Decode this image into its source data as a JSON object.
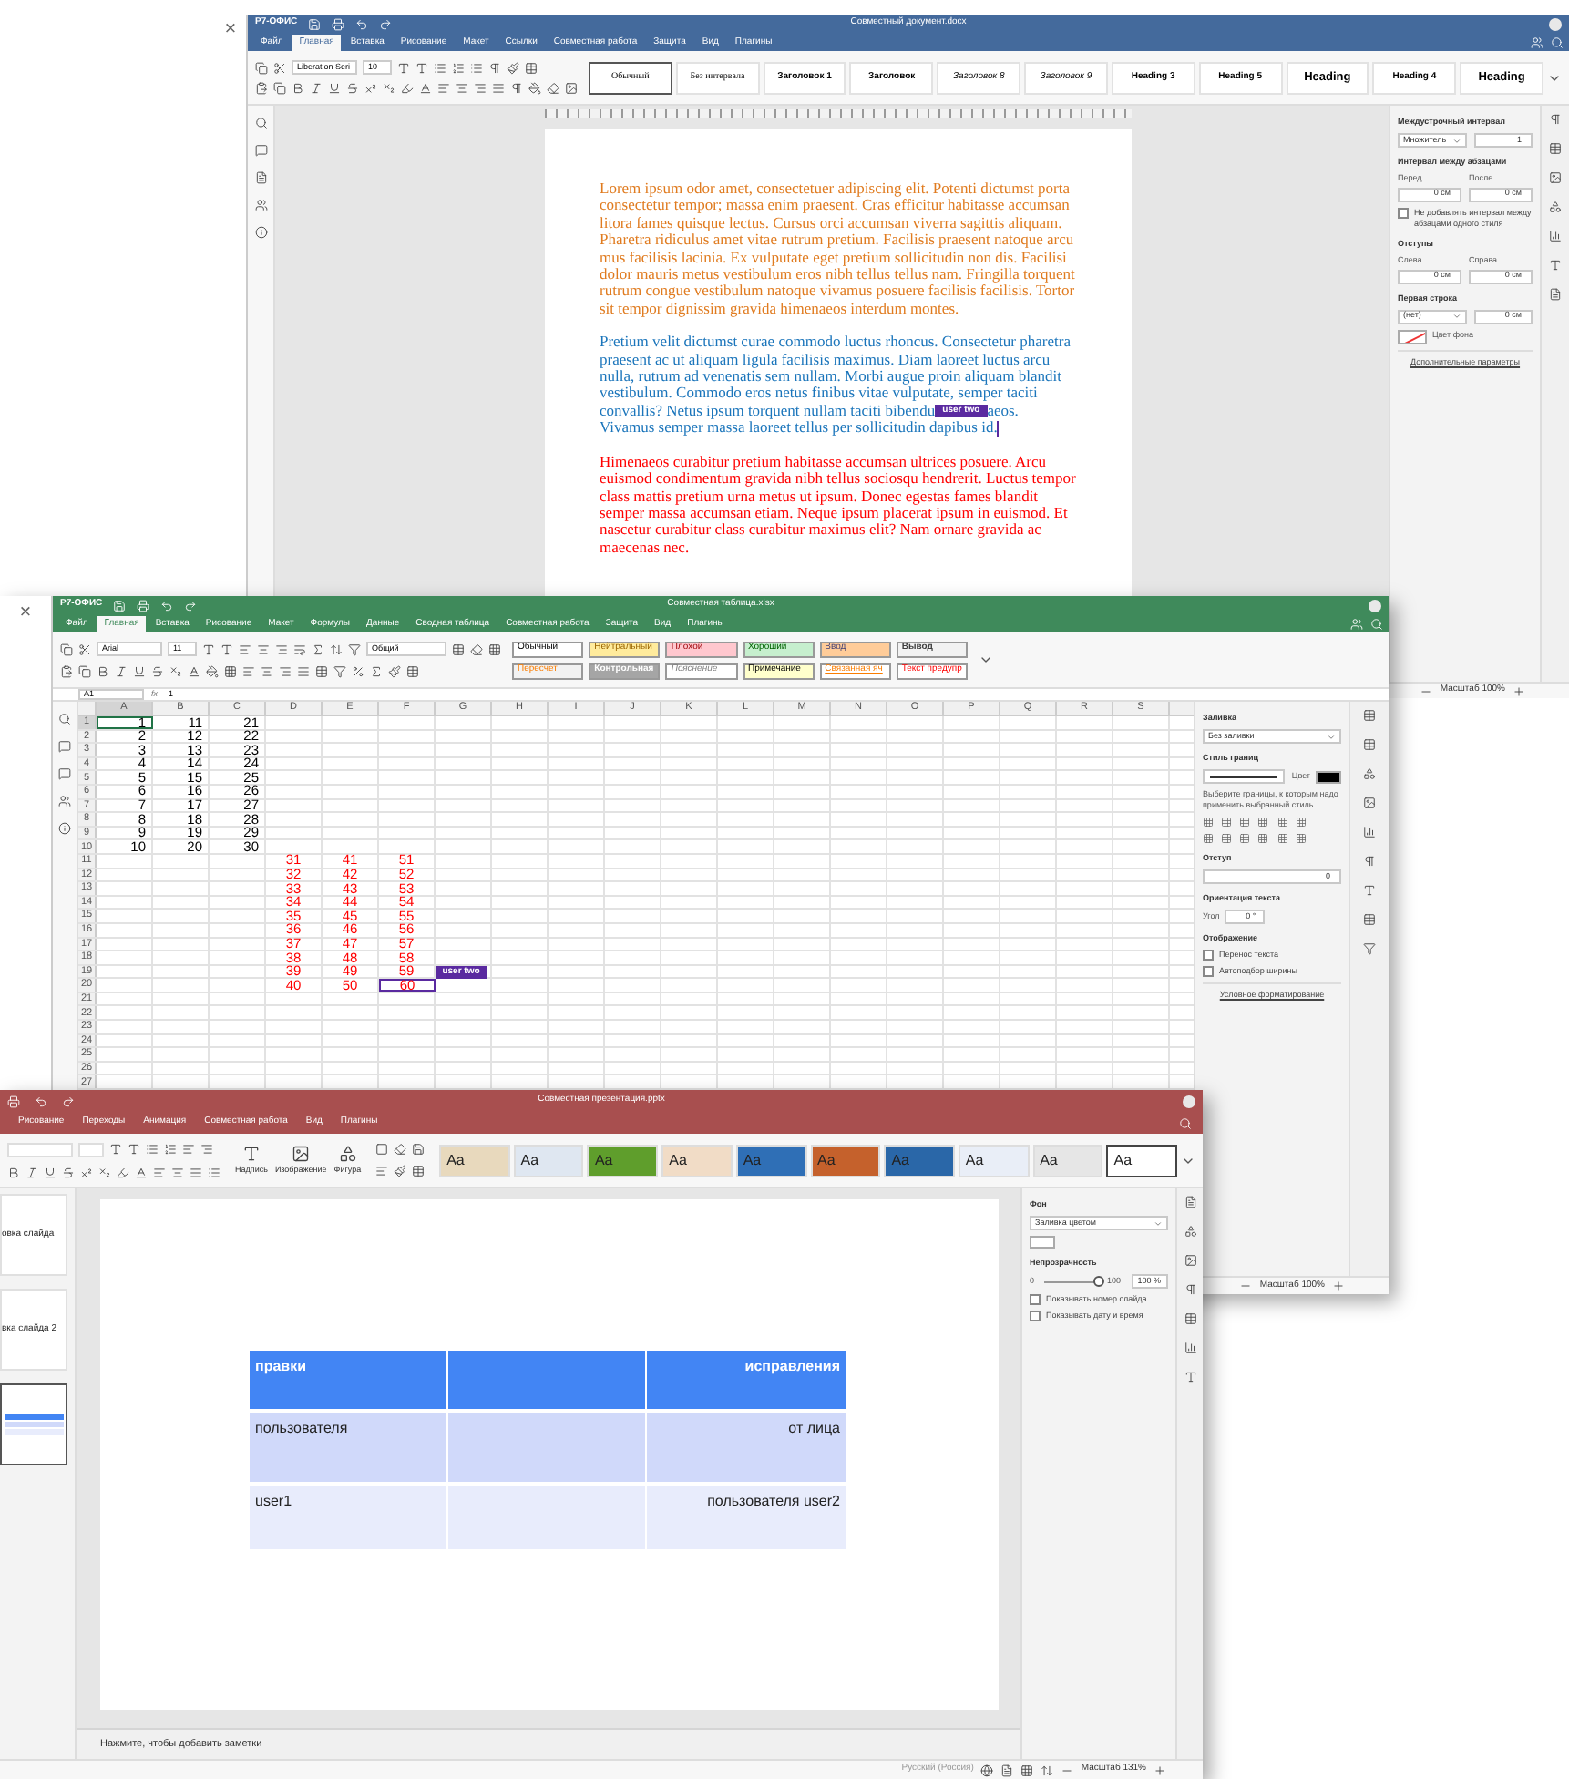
{
  "document_window": {
    "close_glyph": "×",
    "logo": "Р7-ОФИС",
    "title": "Совместный документ.docx",
    "menu": [
      {
        "label": "Файл",
        "selected": false
      },
      {
        "label": "Главная",
        "selected": true
      },
      {
        "label": "Вставка",
        "selected": false
      },
      {
        "label": "Рисование",
        "selected": false
      },
      {
        "label": "Макет",
        "selected": false
      },
      {
        "label": "Ссылки",
        "selected": false
      },
      {
        "label": "Совместная работа",
        "selected": false
      },
      {
        "label": "Защита",
        "selected": false
      },
      {
        "label": "Вид",
        "selected": false
      },
      {
        "label": "Плагины",
        "selected": false
      }
    ],
    "font": {
      "name": "Liberation Seri",
      "size": "10"
    },
    "styles": [
      {
        "label": "Обычный",
        "kind": "plain",
        "selected": true
      },
      {
        "label": "Без интервала",
        "kind": "plain",
        "selected": false
      },
      {
        "label": "Заголовок 1",
        "kind": "bold",
        "selected": false
      },
      {
        "label": "Заголовок",
        "kind": "bold",
        "selected": false
      },
      {
        "label": "Заголовок 8",
        "kind": "italic",
        "selected": false
      },
      {
        "label": "Заголовок 9",
        "kind": "italic",
        "selected": false
      },
      {
        "label": "Heading 3",
        "kind": "bold",
        "selected": false
      },
      {
        "label": "Heading 5",
        "kind": "bold",
        "selected": false
      },
      {
        "label": "Heading",
        "kind": "large",
        "selected": false
      },
      {
        "label": "Heading 4",
        "kind": "bold",
        "selected": false
      },
      {
        "label": "Heading",
        "kind": "large",
        "selected": false
      }
    ],
    "paragraphs": [
      {
        "color": "#e07b1f",
        "text": "Lorem ipsum odor amet, consectetuer adipiscing elit. Potenti dictumst porta consectetur tempor; massa enim praesent. Cras efficitur habitasse accumsan litora fames quisque lectus. Cursus orci accumsan viverra sagittis aliquam. Pharetra ridiculus amet vitae rutrum pretium. Facilisis praesent natoque arcu mus facilisis lacinia. Ex vulputate eget pretium sollicitudin non dis. Facilisi dolor mauris metus vestibulum eros nibh tellus tellus nam. Fringilla torquent rutrum congue vestibulum natoque vivamus posuere facilisis facilisis. Tortor sit tempor dignissim gravida himenaeos interdum montes."
      },
      {
        "color": "#1b75bb",
        "text": "Pretium velit dictumst curae commodo luctus rhoncus. Consectetur pharetra praesent ac ut aliquam ligula facilisis maximus. Diam laoreet luctus arcu nulla, rutrum ad venenatis sem nullam. Morbi augue proin aliquam blandit vestibulum. Commodo eros netus finibus vitae vulputate, semper taciti convallis? Netus ipsum torquent nullam taciti bibendu",
        "remote_tag": "user two",
        "text_after": "aeos. Vivamus semper massa laoreet tellus per sollicitudin dapibus id."
      },
      {
        "color": "#ff0000",
        "text": "Himenaeos curabitur pretium habitasse accumsan ultrices posuere. Arcu euismod condimentum gravida nibh tellus sociosqu hendrerit. Luctus tempor class mattis pretium urna metus ut ipsum. Donec egestas fames blandit semper massa accumsan etiam. Neque ipsum placerat ipsum in euismod. Et nascetur curabitur class curabitur maximus elit? Nam ornare gravida ac maecenas nec."
      }
    ],
    "panel": [
      {
        "kind": "heading",
        "text": "Междустрочный интервал"
      },
      {
        "kind": "row",
        "fields": [
          {
            "kind": "dropdown",
            "value": "Множитель"
          },
          {
            "kind": "spinner",
            "value": "1"
          }
        ]
      },
      {
        "kind": "heading",
        "text": "Интервал между абзацами"
      },
      {
        "kind": "row",
        "fields": [
          {
            "kind": "spinner",
            "label": "Перед",
            "value": "0 см"
          },
          {
            "kind": "spinner",
            "label": "После",
            "value": "0 см"
          }
        ]
      },
      {
        "kind": "checkbox",
        "text": "Не добавлять интервал между абзацами одного стиля",
        "checked": false
      },
      {
        "kind": "heading",
        "text": "Отступы"
      },
      {
        "kind": "row",
        "fields": [
          {
            "kind": "spinner",
            "label": "Слева",
            "value": "0 см"
          },
          {
            "kind": "spinner",
            "label": "Справа",
            "value": "0 см"
          }
        ]
      },
      {
        "kind": "heading",
        "text": "Первая строка"
      },
      {
        "kind": "row",
        "fields": [
          {
            "kind": "dropdown",
            "value": "(нет)"
          },
          {
            "kind": "spinner",
            "value": "0 см"
          }
        ]
      },
      {
        "kind": "row",
        "fields": [
          {
            "kind": "empty_swatch",
            "label": "Цвет фона"
          }
        ]
      },
      {
        "kind": "link",
        "text": "Дополнительные параметры"
      }
    ],
    "status": {
      "zoom": "Масштаб 100%"
    }
  },
  "spreadsheet_window": {
    "close_glyph": "×",
    "logo": "Р7-ОФИС",
    "title": "Совместная таблица.xlsx",
    "menu": [
      {
        "label": "Файл",
        "selected": false
      },
      {
        "label": "Главная",
        "selected": true
      },
      {
        "label": "Вставка",
        "selected": false
      },
      {
        "label": "Рисование",
        "selected": false
      },
      {
        "label": "Макет",
        "selected": false
      },
      {
        "label": "Формулы",
        "selected": false
      },
      {
        "label": "Данные",
        "selected": false
      },
      {
        "label": "Сводная таблица",
        "selected": false
      },
      {
        "label": "Совместная работа",
        "selected": false
      },
      {
        "label": "Защита",
        "selected": false
      },
      {
        "label": "Вид",
        "selected": false
      },
      {
        "label": "Плагины",
        "selected": false
      }
    ],
    "font": {
      "name": "Arial",
      "size": "11"
    },
    "number_format": "Общий",
    "cell_styles": [
      {
        "label": "Обычный",
        "color": "#ffffff",
        "kind": "normal"
      },
      {
        "label": "Нейтральный",
        "color": "#ffeb9c",
        "kind": "neutral"
      },
      {
        "label": "Плохой",
        "color": "#ffc7ce",
        "kind": "bad"
      },
      {
        "label": "Хороший",
        "color": "#c6efce",
        "kind": "good"
      },
      {
        "label": "Ввод",
        "color": "#ffcc99",
        "kind": "input"
      },
      {
        "label": "Вывод",
        "color": "#f2f2f2",
        "kind": "output"
      },
      {
        "label": "Пересчет",
        "color": "#f2f2f2",
        "kind": "calculation"
      },
      {
        "label": "Контрольная",
        "color": "#a5a5a5",
        "kind": "check"
      },
      {
        "label": "Пояснение",
        "color": "#ffffff",
        "kind": "explanatory"
      },
      {
        "label": "Примечание",
        "color": "#ffffcc",
        "kind": "note"
      },
      {
        "label": "Связанная яч",
        "color": "#ffffff",
        "kind": "linked"
      },
      {
        "label": "Текст предупр",
        "color": "#ffffff",
        "kind": "warning"
      }
    ],
    "name_box": "A1",
    "function_glyph": "fx",
    "formula": "1",
    "columns": [
      "A",
      "B",
      "C",
      "D",
      "E",
      "F",
      "G",
      "H",
      "I",
      "J",
      "K",
      "L",
      "M",
      "N",
      "O",
      "P",
      "Q",
      "R",
      "S"
    ],
    "rows": [
      {
        "number": "1",
        "kind": "left_block",
        "cells": [
          {
            "value": "1",
            "color": "#000000",
            "selected": true,
            "remote_cursor": false
          },
          {
            "value": "11",
            "color": "#000000",
            "selected": false,
            "remote_cursor": false
          },
          {
            "value": "21",
            "color": "#000000",
            "selected": false,
            "remote_cursor": false
          }
        ]
      },
      {
        "number": "2",
        "kind": "left_block",
        "cells": [
          {
            "value": "2",
            "color": "#000000",
            "selected": false,
            "remote_cursor": false
          },
          {
            "value": "12",
            "color": "#000000",
            "selected": false,
            "remote_cursor": false
          },
          {
            "value": "22",
            "color": "#000000",
            "selected": false,
            "remote_cursor": false
          }
        ]
      },
      {
        "number": "3",
        "kind": "left_block",
        "cells": [
          {
            "value": "3",
            "color": "#000000",
            "selected": false,
            "remote_cursor": false
          },
          {
            "value": "13",
            "color": "#000000",
            "selected": false,
            "remote_cursor": false
          },
          {
            "value": "23",
            "color": "#000000",
            "selected": false,
            "remote_cursor": false
          }
        ]
      },
      {
        "number": "4",
        "kind": "left_block",
        "cells": [
          {
            "value": "4",
            "color": "#000000",
            "selected": false,
            "remote_cursor": false
          },
          {
            "value": "14",
            "color": "#000000",
            "selected": false,
            "remote_cursor": false
          },
          {
            "value": "24",
            "color": "#000000",
            "selected": false,
            "remote_cursor": false
          }
        ]
      },
      {
        "number": "5",
        "kind": "left_block",
        "cells": [
          {
            "value": "5",
            "color": "#000000",
            "selected": false,
            "remote_cursor": false
          },
          {
            "value": "15",
            "color": "#000000",
            "selected": false,
            "remote_cursor": false
          },
          {
            "value": "25",
            "color": "#000000",
            "selected": false,
            "remote_cursor": false
          }
        ]
      },
      {
        "number": "6",
        "kind": "left_block",
        "cells": [
          {
            "value": "6",
            "color": "#000000",
            "selected": false,
            "remote_cursor": false
          },
          {
            "value": "16",
            "color": "#000000",
            "selected": false,
            "remote_cursor": false
          },
          {
            "value": "26",
            "color": "#000000",
            "selected": false,
            "remote_cursor": false
          }
        ]
      },
      {
        "number": "7",
        "kind": "left_block",
        "cells": [
          {
            "value": "7",
            "color": "#000000",
            "selected": false,
            "remote_cursor": false
          },
          {
            "value": "17",
            "color": "#000000",
            "selected": false,
            "remote_cursor": false
          },
          {
            "value": "27",
            "color": "#000000",
            "selected": false,
            "remote_cursor": false
          }
        ]
      },
      {
        "number": "8",
        "kind": "left_block",
        "cells": [
          {
            "value": "8",
            "color": "#000000",
            "selected": false,
            "remote_cursor": false
          },
          {
            "value": "18",
            "color": "#000000",
            "selected": false,
            "remote_cursor": false
          },
          {
            "value": "28",
            "color": "#000000",
            "selected": false,
            "remote_cursor": false
          }
        ]
      },
      {
        "number": "9",
        "kind": "left_block",
        "cells": [
          {
            "value": "9",
            "color": "#000000",
            "selected": false,
            "remote_cursor": false
          },
          {
            "value": "19",
            "color": "#000000",
            "selected": false,
            "remote_cursor": false
          },
          {
            "value": "29",
            "color": "#000000",
            "selected": false,
            "remote_cursor": false
          }
        ]
      },
      {
        "number": "10",
        "kind": "left_block",
        "cells": [
          {
            "value": "10",
            "color": "#000000",
            "selected": false,
            "remote_cursor": false
          },
          {
            "value": "20",
            "color": "#000000",
            "selected": false,
            "remote_cursor": false
          },
          {
            "value": "30",
            "color": "#000000",
            "selected": false,
            "remote_cursor": false
          }
        ]
      },
      {
        "number": "11",
        "kind": "middle_block",
        "cells": [
          {
            "value": "31",
            "color": "#ff0000",
            "selected": false,
            "remote_cursor": false
          },
          {
            "value": "41",
            "color": "#ff0000",
            "selected": false,
            "remote_cursor": false
          },
          {
            "value": "51",
            "color": "#ff0000",
            "selected": false,
            "remote_cursor": false
          }
        ]
      },
      {
        "number": "12",
        "kind": "middle_block",
        "cells": [
          {
            "value": "32",
            "color": "#ff0000",
            "selected": false,
            "remote_cursor": false
          },
          {
            "value": "42",
            "color": "#ff0000",
            "selected": false,
            "remote_cursor": false
          },
          {
            "value": "52",
            "color": "#ff0000",
            "selected": false,
            "remote_cursor": false
          }
        ]
      },
      {
        "number": "13",
        "kind": "middle_block",
        "cells": [
          {
            "value": "33",
            "color": "#ff0000",
            "selected": false,
            "remote_cursor": false
          },
          {
            "value": "43",
            "color": "#ff0000",
            "selected": false,
            "remote_cursor": false
          },
          {
            "value": "53",
            "color": "#ff0000",
            "selected": false,
            "remote_cursor": false
          }
        ]
      },
      {
        "number": "14",
        "kind": "middle_block",
        "cells": [
          {
            "value": "34",
            "color": "#ff0000",
            "selected": false,
            "remote_cursor": false
          },
          {
            "value": "44",
            "color": "#ff0000",
            "selected": false,
            "remote_cursor": false
          },
          {
            "value": "54",
            "color": "#ff0000",
            "selected": false,
            "remote_cursor": false
          }
        ]
      },
      {
        "number": "15",
        "kind": "middle_block",
        "cells": [
          {
            "value": "35",
            "color": "#ff0000",
            "selected": false,
            "remote_cursor": false
          },
          {
            "value": "45",
            "color": "#ff0000",
            "selected": false,
            "remote_cursor": false
          },
          {
            "value": "55",
            "color": "#ff0000",
            "selected": false,
            "remote_cursor": false
          }
        ]
      },
      {
        "number": "16",
        "kind": "middle_block",
        "cells": [
          {
            "value": "36",
            "color": "#ff0000",
            "selected": false,
            "remote_cursor": false
          },
          {
            "value": "46",
            "color": "#ff0000",
            "selected": false,
            "remote_cursor": false
          },
          {
            "value": "56",
            "color": "#ff0000",
            "selected": false,
            "remote_cursor": false
          }
        ]
      },
      {
        "number": "17",
        "kind": "middle_block",
        "cells": [
          {
            "value": "37",
            "color": "#ff0000",
            "selected": false,
            "remote_cursor": false
          },
          {
            "value": "47",
            "color": "#ff0000",
            "selected": false,
            "remote_cursor": false
          },
          {
            "value": "57",
            "color": "#ff0000",
            "selected": false,
            "remote_cursor": false
          }
        ]
      },
      {
        "number": "18",
        "kind": "middle_block",
        "cells": [
          {
            "value": "38",
            "color": "#ff0000",
            "selected": false,
            "remote_cursor": false
          },
          {
            "value": "48",
            "color": "#ff0000",
            "selected": false,
            "remote_cursor": false
          },
          {
            "value": "58",
            "color": "#ff0000",
            "selected": false,
            "remote_cursor": false
          }
        ]
      },
      {
        "number": "19",
        "kind": "middle_block",
        "cells": [
          {
            "value": "39",
            "color": "#ff0000",
            "selected": false,
            "remote_cursor": false
          },
          {
            "value": "49",
            "color": "#ff0000",
            "selected": false,
            "remote_cursor": false
          },
          {
            "value": "59",
            "color": "#ff0000",
            "selected": false,
            "remote_cursor": false
          }
        ]
      },
      {
        "number": "20",
        "kind": "middle_block",
        "cells": [
          {
            "value": "40",
            "color": "#ff0000",
            "selected": false,
            "remote_cursor": false
          },
          {
            "value": "50",
            "color": "#ff0000",
            "selected": false,
            "remote_cursor": false
          },
          {
            "value": "60",
            "color": "#ff0000",
            "selected": false,
            "remote_cursor": true
          }
        ]
      },
      {
        "number": "21"
      },
      {
        "number": "22"
      },
      {
        "number": "23"
      },
      {
        "number": "24"
      },
      {
        "number": "25"
      },
      {
        "number": "26"
      },
      {
        "number": "27"
      }
    ],
    "remote_tag": "user two",
    "panel": [
      {
        "kind": "heading",
        "text": "Заливка"
      },
      {
        "kind": "row",
        "fields": [
          {
            "kind": "dropdown",
            "value": "Без заливки"
          }
        ]
      },
      {
        "kind": "heading",
        "text": "Стиль границ"
      },
      {
        "kind": "row",
        "fields": [
          {
            "kind": "line"
          },
          {
            "kind": "color",
            "label": "Цвет",
            "color": "#000000"
          }
        ]
      },
      {
        "kind": "label",
        "text": "Выберите границы, к которым надо применить выбранный стиль"
      },
      {
        "kind": "border_icons"
      },
      {
        "kind": "heading",
        "text": "Отступ"
      },
      {
        "kind": "row",
        "fields": [
          {
            "kind": "spinner",
            "value": "0"
          }
        ]
      },
      {
        "kind": "heading",
        "text": "Ориентация текста"
      },
      {
        "kind": "row",
        "fields": [
          {
            "kind": "inline_spinner",
            "label": "Угол",
            "value": "0 °"
          }
        ]
      },
      {
        "kind": "heading",
        "text": "Отображение"
      },
      {
        "kind": "checkbox",
        "text": "Перенос текста",
        "checked": false
      },
      {
        "kind": "checkbox",
        "text": "Автоподбор ширины",
        "checked": false
      },
      {
        "kind": "link",
        "text": "Условное форматирование"
      }
    ],
    "status": {
      "zoom": "Масштаб 100%"
    }
  },
  "presentation_window": {
    "title": "Совместная презентация.pptx",
    "menu": [
      {
        "label": "Рисование",
        "selected": false
      },
      {
        "label": "Переходы",
        "selected": false
      },
      {
        "label": "Анимация",
        "selected": false
      },
      {
        "label": "Совместная работа",
        "selected": false
      },
      {
        "label": "Вид",
        "selected": false
      },
      {
        "label": "Плагины",
        "selected": false
      }
    ],
    "insert_tools": [
      {
        "label": "Надпись"
      },
      {
        "label": "Изображение"
      },
      {
        "label": "Фигура"
      }
    ],
    "themes": [
      {
        "label": "Aa",
        "color": "#e8d9bd",
        "selected": false
      },
      {
        "label": "Aa",
        "color": "#dfe7f1",
        "selected": false
      },
      {
        "label": "Aa",
        "color": "#5f9e2c",
        "selected": false
      },
      {
        "label": "Aa",
        "color": "#f1dcc6",
        "selected": false
      },
      {
        "label": "Aa",
        "color": "#2f6fb6",
        "selected": false
      },
      {
        "label": "Aa",
        "color": "#c5612c",
        "selected": false
      },
      {
        "label": "Aa",
        "color": "#2a67a8",
        "selected": false
      },
      {
        "label": "Aa",
        "color": "#e9eef7",
        "selected": false
      },
      {
        "label": "Aa",
        "color": "#e6e6e6",
        "selected": false
      },
      {
        "label": "Aa",
        "color": "#ffffff",
        "selected": true
      }
    ],
    "slides": [
      {
        "kind": "title",
        "title": "овка слайда",
        "selected": false
      },
      {
        "kind": "title",
        "title": "вка слайда 2",
        "selected": false
      },
      {
        "kind": "table",
        "selected": true
      }
    ],
    "table": {
      "rows": [
        {
          "kind": "header",
          "left": "правки",
          "right": "исправления"
        },
        {
          "kind": "band1",
          "left": "пользователя",
          "right": "от лица"
        },
        {
          "kind": "band2",
          "left": "user1",
          "right": "пользователя user2"
        }
      ]
    },
    "notes_placeholder": "Нажмите, чтобы добавить заметки",
    "panel": [
      {
        "kind": "heading",
        "text": "Фон"
      },
      {
        "kind": "row",
        "fields": [
          {
            "kind": "dropdown",
            "value": "Заливка цветом"
          }
        ]
      },
      {
        "kind": "row",
        "fields": [
          {
            "kind": "color",
            "color": "#ffffff"
          }
        ]
      },
      {
        "kind": "heading",
        "text": "Непрозрачность"
      },
      {
        "kind": "slider",
        "min": "0",
        "max": "100",
        "level": 1,
        "reading": "100 %"
      },
      {
        "kind": "checkbox",
        "text": "Показывать номер слайда",
        "checked": false
      },
      {
        "kind": "checkbox",
        "text": "Показывать дату и время",
        "checked": false
      }
    ],
    "status": {
      "language": "Русский (Россия)",
      "zoom": "Масштаб 131%"
    }
  }
}
